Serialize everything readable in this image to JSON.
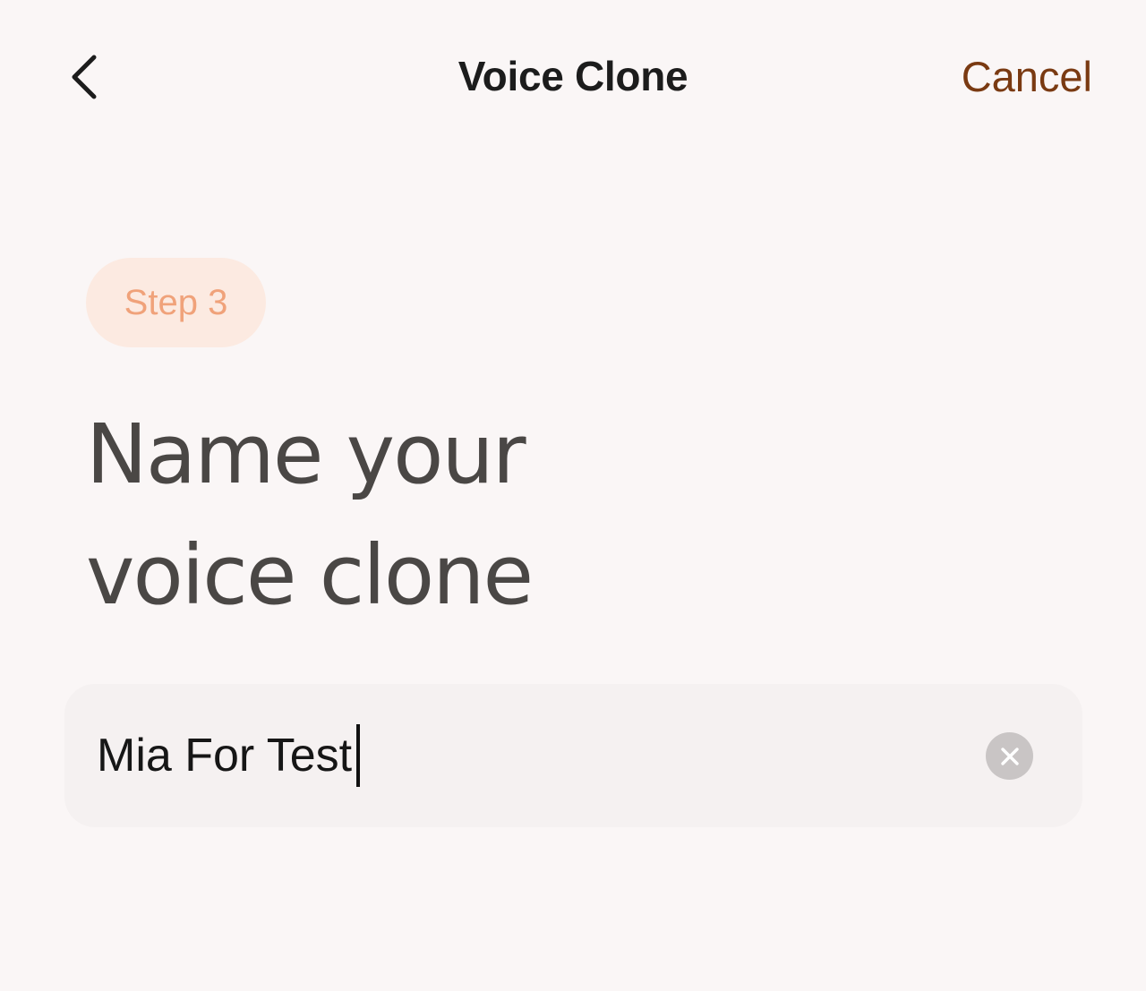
{
  "header": {
    "title": "Voice Clone",
    "cancel_label": "Cancel",
    "back_icon": "chevron-left-icon"
  },
  "step": {
    "label": "Step 3",
    "badge_text_color": "#f0a27a",
    "badge_bg_color": "#fceae1"
  },
  "main": {
    "heading_line1": "Name your",
    "heading_line2": "voice clone"
  },
  "name_field": {
    "value": "Mia For Test",
    "clear_icon": "clear-icon"
  },
  "colors": {
    "background": "#faf6f6",
    "accent": "#7a3a12",
    "heading": "#4a4745"
  }
}
